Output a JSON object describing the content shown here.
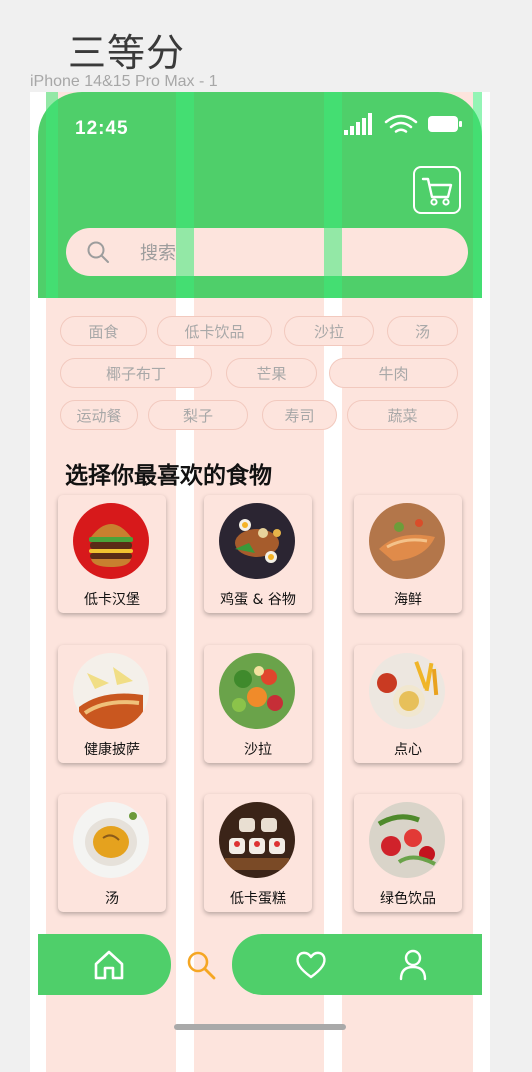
{
  "canvas": {
    "title": "三等分",
    "frame_label": "iPhone 14&15 Pro Max - 1"
  },
  "status_bar": {
    "time": "12:45"
  },
  "header": {
    "cart_icon": "cart-icon"
  },
  "search": {
    "placeholder": "搜索"
  },
  "chips": [
    {
      "label": "面食"
    },
    {
      "label": "低卡饮品"
    },
    {
      "label": "沙拉"
    },
    {
      "label": "汤"
    },
    {
      "label": "椰子布丁"
    },
    {
      "label": "芒果"
    },
    {
      "label": "牛肉"
    },
    {
      "label": "运动餐"
    },
    {
      "label": "梨子"
    },
    {
      "label": "寿司"
    },
    {
      "label": "蔬菜"
    }
  ],
  "section": {
    "title": "选择你最喜欢的食物"
  },
  "cards": [
    {
      "label": "低卡汉堡"
    },
    {
      "label": "鸡蛋 & 谷物"
    },
    {
      "label": "海鲜"
    },
    {
      "label": "健康披萨"
    },
    {
      "label": "沙拉"
    },
    {
      "label": "点心"
    },
    {
      "label": "汤"
    },
    {
      "label": "低卡蛋糕"
    },
    {
      "label": "绿色饮品"
    }
  ],
  "nav": {
    "items": [
      "home-icon",
      "search-icon",
      "heart-icon",
      "user-icon"
    ],
    "active": "search-icon"
  },
  "colors": {
    "accent": "#4fcf6a",
    "background": "#fde4dd",
    "active_nav": "#f5a623"
  }
}
